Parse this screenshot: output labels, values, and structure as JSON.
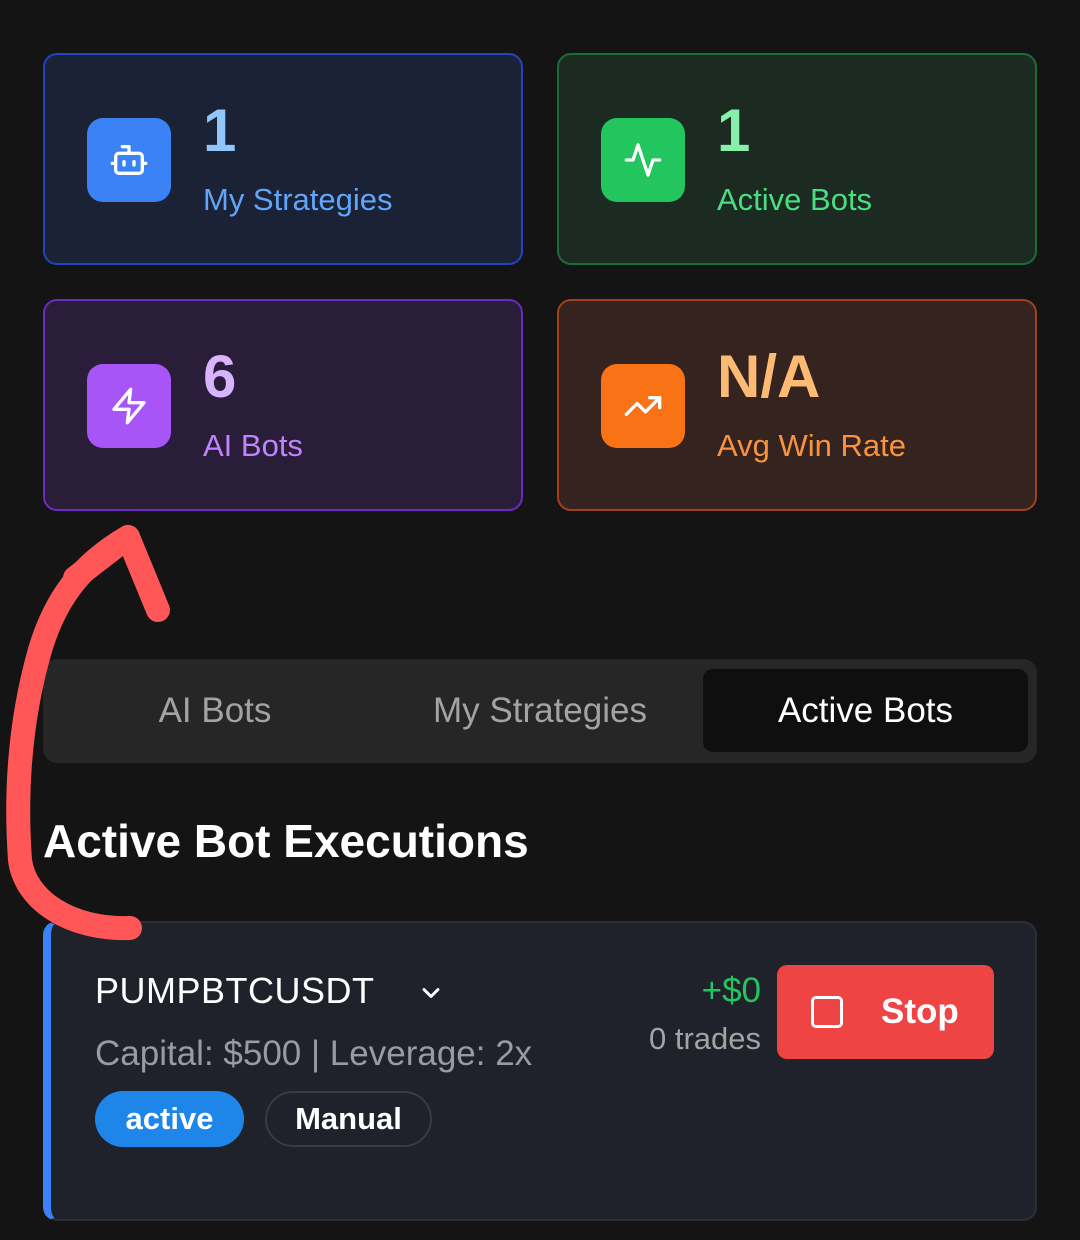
{
  "stats": [
    {
      "value": "1",
      "label": "My Strategies",
      "icon": "robot-icon",
      "accent": "#3b82f6"
    },
    {
      "value": "1",
      "label": "Active Bots",
      "icon": "activity-icon",
      "accent": "#22c55e"
    },
    {
      "value": "6",
      "label": "AI Bots",
      "icon": "zap-icon",
      "accent": "#a855f7"
    },
    {
      "value": "N/A",
      "label": "Avg Win Rate",
      "icon": "trending-up-icon",
      "accent": "#f97316"
    }
  ],
  "tabs": [
    {
      "label": "AI Bots",
      "active": false
    },
    {
      "label": "My Strategies",
      "active": false
    },
    {
      "label": "Active Bots",
      "active": true
    }
  ],
  "section_title": "Active Bot Executions",
  "execution": {
    "symbol": "PUMPBTCUSDT",
    "capital_text": "Capital: $500 | Leverage: 2x",
    "pnl": "+$0",
    "trades": "0 trades",
    "stop_label": "Stop",
    "status_badge": "active",
    "mode_badge": "Manual",
    "colors": {
      "status": "#1e86e8",
      "stop": "#ef4444",
      "pnl_positive": "#22c55e"
    }
  },
  "annotation": {
    "type": "hand-drawn-arrow",
    "color": "#ff5757"
  }
}
